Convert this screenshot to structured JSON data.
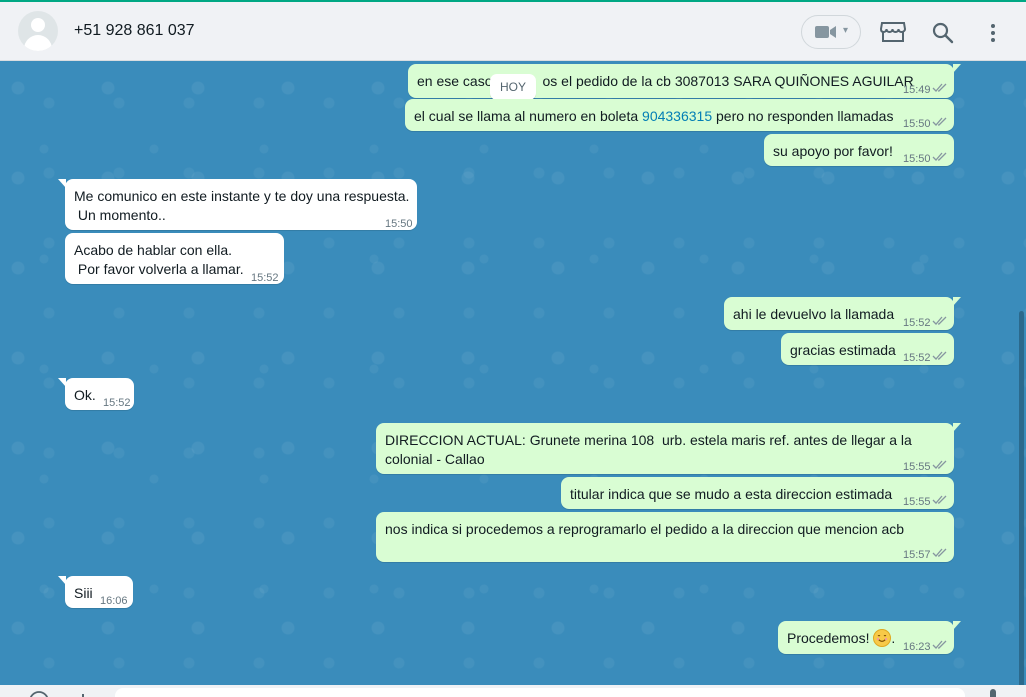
{
  "header": {
    "contact_name": "+51 928 861 037",
    "icons": [
      "video-call-icon",
      "store-icon",
      "search-icon",
      "menu-icon"
    ]
  },
  "chat": {
    "date_chip": "HOY",
    "messages": [
      {
        "dir": "out",
        "text": "en ese caso ... os el pedido de la cb 3087013 SARA QUIÑONES AGUILAR",
        "parts": [
          "en ese caso",
          "os el pedido de la cb 3087013 SARA QUIÑONES AGUILAR"
        ],
        "time": "15:49"
      },
      {
        "dir": "out",
        "text": "el cual se llama al numero en boleta 904336315 pero no responden llamadas",
        "before": "el cual se llama al numero en boleta ",
        "link": "904336315",
        "after": " pero no responden llamadas",
        "time": "15:50"
      },
      {
        "dir": "out",
        "text": "su apoyo por favor!",
        "time": "15:50"
      },
      {
        "dir": "in",
        "line1": "Me comunico en este instante y te doy una respuesta.",
        "line2": " Un momento..",
        "time": "15:50"
      },
      {
        "dir": "in",
        "line1": "Acabo de hablar con ella.",
        "line2": " Por favor volverla a llamar.",
        "time": "15:52"
      },
      {
        "dir": "out",
        "text": "ahi le devuelvo la llamada",
        "time": "15:52"
      },
      {
        "dir": "out",
        "text": "gracias estimada",
        "time": "15:52"
      },
      {
        "dir": "in",
        "text": "Ok.",
        "time": "15:52"
      },
      {
        "dir": "out",
        "line1": "DIRECCION ACTUAL: Grunete merina 108  urb. estela maris ref. antes de llegar a la",
        "line2": "colonial - Callao",
        "time": "15:55"
      },
      {
        "dir": "out",
        "text": "titular indica que se mudo a esta direccion estimada",
        "time": "15:55"
      },
      {
        "dir": "out",
        "text": "nos indica si procedemos a reprogramarlo el pedido a la direccion que mencion acb",
        "time": "15:57"
      },
      {
        "dir": "in",
        "text": "Siii",
        "time": "16:06"
      },
      {
        "dir": "out",
        "text": "Procedemos!",
        "emoji": "smiling-face-emoji",
        "time": "16:23"
      }
    ]
  },
  "colors": {
    "accent": "#00a884",
    "bubble_out": "#d9fdd3",
    "bubble_in": "#ffffff",
    "wallpaper": "#3a8cbb",
    "link": "#027eb5"
  }
}
